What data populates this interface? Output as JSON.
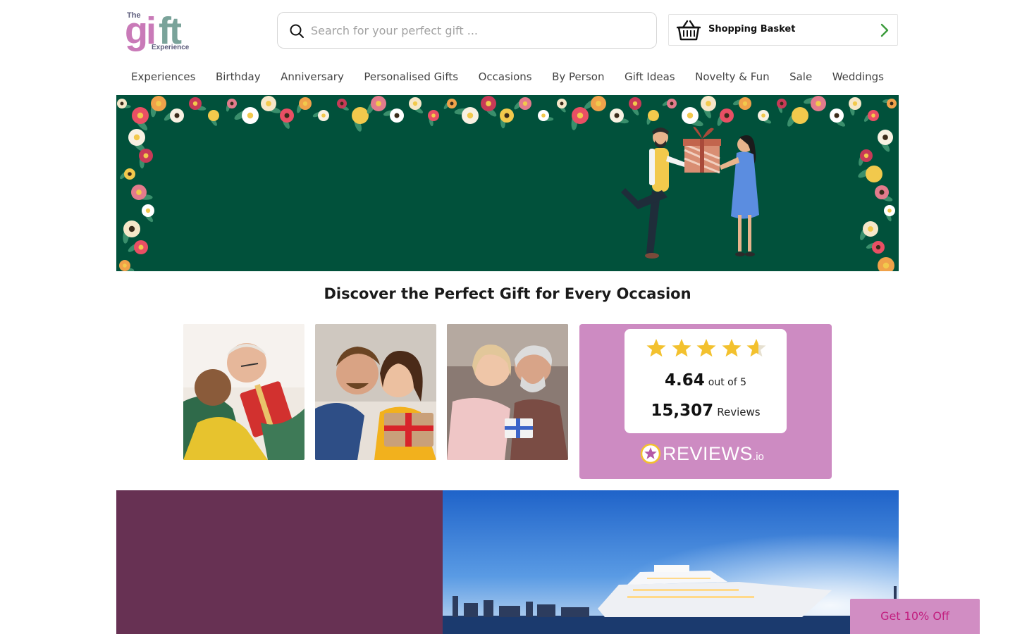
{
  "brand": {
    "logo_the": "The",
    "logo_gift": "gift",
    "logo_experience": "Experience"
  },
  "search": {
    "placeholder": "Search for your perfect gift ..."
  },
  "basket": {
    "label": "Shopping Basket"
  },
  "nav": {
    "items": [
      {
        "label": "Experiences"
      },
      {
        "label": "Birthday"
      },
      {
        "label": "Anniversary"
      },
      {
        "label": "Personalised Gifts"
      },
      {
        "label": "Occasions"
      },
      {
        "label": "By Person"
      },
      {
        "label": "Gift Ideas"
      },
      {
        "label": "Novelty & Fun"
      },
      {
        "label": "Sale"
      },
      {
        "label": "Weddings"
      }
    ]
  },
  "section": {
    "heading": "Discover the Perfect Gift for Every Occasion"
  },
  "reviews": {
    "rating": "4.64",
    "rating_suffix": "out of 5",
    "count": "15,307",
    "count_suffix": "Reviews",
    "stars": 4.64,
    "brand": "REVIEWS",
    "brand_suffix": ".io"
  },
  "promo_button": {
    "label": "Get 10% Off"
  },
  "colors": {
    "hero_green": "#01513b",
    "reviews_pink": "#cd8bc2",
    "promo_plum": "#673153",
    "star_gold": "#f3c12e",
    "discount_text": "#c21f7f"
  },
  "icons": {
    "search": "search-icon",
    "basket": "basket-icon",
    "arrow": "chevron-right-icon",
    "star": "star-icon"
  }
}
